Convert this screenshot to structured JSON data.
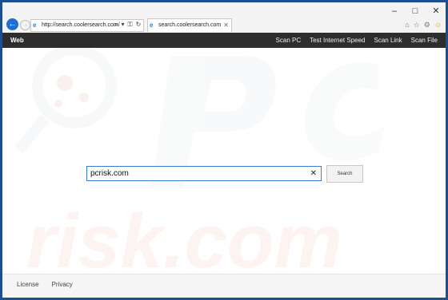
{
  "browser": {
    "address_url": "http://search.coolersearch.com/",
    "tab_title": "search.coolersearch.com",
    "window_controls": [
      "–",
      "□",
      "✕"
    ],
    "icons": [
      "back-arrow-icon",
      "forward-arrow-icon",
      "ie-logo-icon",
      "search-icon",
      "lock-icon",
      "refresh-icon",
      "home-icon",
      "favorites-star-icon",
      "settings-gear-icon",
      "smiley-feedback-icon"
    ]
  },
  "nav": {
    "brand": "Web",
    "links": [
      "Scan PC",
      "Test Internet Speed",
      "Scan Link",
      "Scan File"
    ]
  },
  "search": {
    "value": "pcrisk.com",
    "clear_label": "✕",
    "button_label": "Search"
  },
  "footer": {
    "links": [
      "License",
      "Privacy"
    ]
  },
  "colors": {
    "frame": "#1b4f8f",
    "navbar": "#2d2d2d",
    "search_border": "#3b7bd0"
  }
}
